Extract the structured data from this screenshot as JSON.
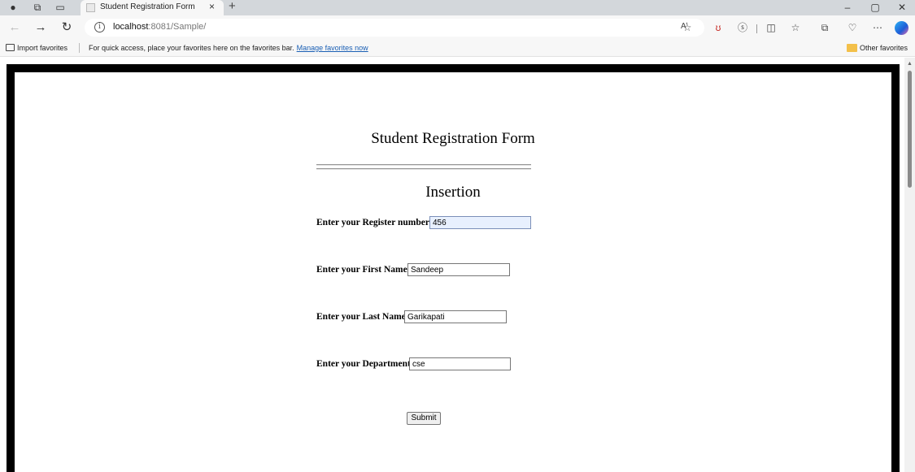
{
  "browser": {
    "tab": {
      "title": "Student Registration Form",
      "close_glyph": "×"
    },
    "new_tab_glyph": "+",
    "window_controls": {
      "minimize": "–",
      "restore": "▢",
      "close": "✕"
    },
    "address": {
      "host": "localhost",
      "path": ":8081/Sample/"
    },
    "read_aloud_glyph": "Aʹ",
    "favorites_bar": {
      "import_label": "Import favorites",
      "hint_text": "For quick access, place your favorites here on the favorites bar.",
      "manage_link": "Manage favorites now",
      "other_label": "Other favorites"
    },
    "icons": {
      "profile": "profile-icon",
      "workspaces": "workspaces-icon",
      "tab_actions": "tab-actions-icon",
      "back": "back-arrow-icon",
      "forward": "forward-arrow-icon",
      "refresh": "refresh-icon",
      "site_info": "info-icon",
      "favorite": "star-icon",
      "more": "more-icon"
    },
    "toolbar_glyphs": {
      "profile": "●",
      "workspaces": "⧉",
      "tab_actions": "▭",
      "back": "←",
      "forward": "→",
      "refresh": "↻",
      "site_info": "i",
      "favorite": "☆",
      "pdf": "ʊ",
      "extensions": "ⓢ",
      "split": "◫",
      "favorites": "☆",
      "collections": "⧉",
      "performance": "♡",
      "more": "⋯"
    }
  },
  "form": {
    "title": "Student Registration Form",
    "section_title": "Insertion",
    "fields": [
      {
        "label": "Enter your Register number:",
        "value": "456"
      },
      {
        "label": "Enter your First Name:",
        "value": "Sandeep"
      },
      {
        "label": "Enter your Last Name:",
        "value": "Garikapati"
      },
      {
        "label": "Enter your Department:",
        "value": "cse"
      }
    ],
    "submit_label": "Submit"
  },
  "colors": {
    "tab_strip": "#d3d7db",
    "toolbar": "#f7f7f7",
    "link": "#1a5fb4",
    "page_frame": "#000000",
    "focused_input": "#e8f0fe"
  }
}
